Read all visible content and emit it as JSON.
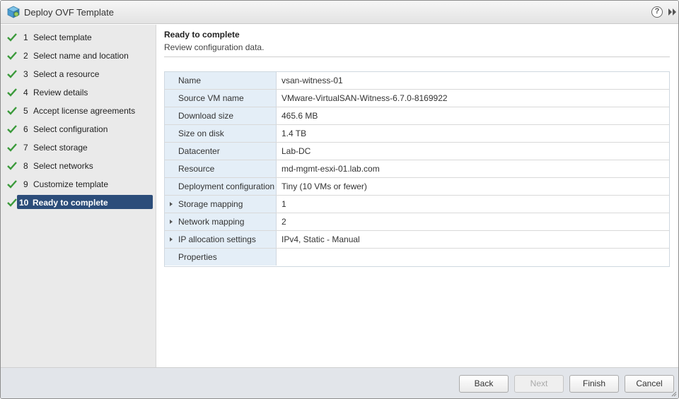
{
  "window": {
    "title": "Deploy OVF Template",
    "help_glyph": "?",
    "icons": [
      "ovf-package-icon",
      "help-icon",
      "expand-icon",
      "resize-grip-icon"
    ]
  },
  "steps": [
    {
      "num": "1",
      "label": "Select template"
    },
    {
      "num": "2",
      "label": "Select name and location"
    },
    {
      "num": "3",
      "label": "Select a resource"
    },
    {
      "num": "4",
      "label": "Review details"
    },
    {
      "num": "5",
      "label": "Accept license agreements"
    },
    {
      "num": "6",
      "label": "Select configuration"
    },
    {
      "num": "7",
      "label": "Select storage"
    },
    {
      "num": "8",
      "label": "Select networks"
    },
    {
      "num": "9",
      "label": "Customize template"
    },
    {
      "num": "10",
      "label": "Ready to complete"
    }
  ],
  "page": {
    "title": "Ready to complete",
    "subtitle": "Review configuration data."
  },
  "details": [
    {
      "key": "Name",
      "value": "vsan-witness-01",
      "expandable": false
    },
    {
      "key": "Source VM name",
      "value": "VMware-VirtualSAN-Witness-6.7.0-8169922",
      "expandable": false
    },
    {
      "key": "Download size",
      "value": "465.6 MB",
      "expandable": false
    },
    {
      "key": "Size on disk",
      "value": "1.4 TB",
      "expandable": false
    },
    {
      "key": "Datacenter",
      "value": "Lab-DC",
      "expandable": false
    },
    {
      "key": "Resource",
      "value": "md-mgmt-esxi-01.lab.com",
      "expandable": false
    },
    {
      "key": "Deployment configuration",
      "value": "Tiny (10 VMs or fewer)",
      "expandable": false
    },
    {
      "key": "Storage mapping",
      "value": "1",
      "expandable": true
    },
    {
      "key": "Network mapping",
      "value": "2",
      "expandable": true
    },
    {
      "key": "IP allocation settings",
      "value": "IPv4, Static - Manual",
      "expandable": true
    },
    {
      "key": "Properties",
      "value": "",
      "expandable": false
    }
  ],
  "buttons": {
    "back": "Back",
    "next": "Next",
    "finish": "Finish",
    "cancel": "Cancel"
  },
  "colors": {
    "active_step": "#2c4d7a",
    "check": "#3a9a3a",
    "key_cell": "#e4eef7"
  }
}
